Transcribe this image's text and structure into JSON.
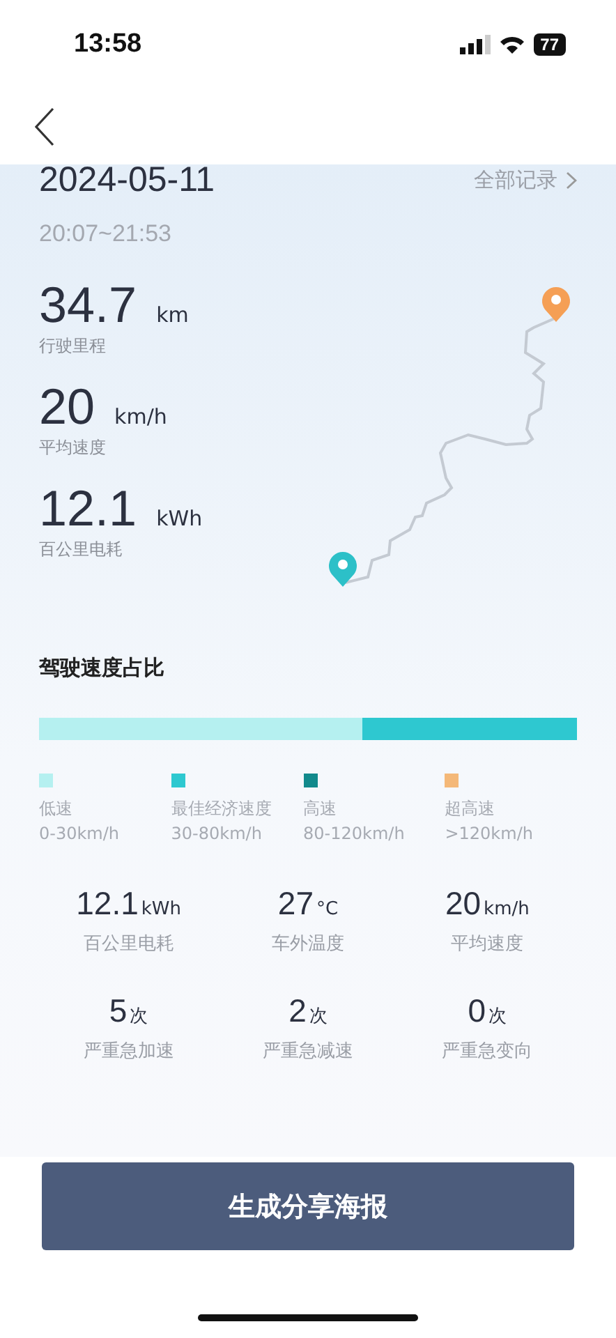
{
  "status_bar": {
    "time": "13:58",
    "battery": "77"
  },
  "header": {
    "date": "2024-05-11",
    "time_range": "20:07~21:53",
    "all_records_link": "全部记录"
  },
  "trip_stats": [
    {
      "value": "34.7",
      "unit": "km",
      "label": "行驶里程"
    },
    {
      "value": "20",
      "unit": "km/h",
      "label": "平均速度"
    },
    {
      "value": "12.1",
      "unit": "kWh",
      "label": "百公里电耗"
    }
  ],
  "speed_section": {
    "title": "驾驶速度占比",
    "bar": [
      {
        "color": "#b5f0f0",
        "level": 0.6
      },
      {
        "color": "#2ec8d0",
        "level": 0.4
      }
    ],
    "bands": [
      {
        "name": "低速",
        "range": "0-30km/h",
        "color": "#b5f0f0"
      },
      {
        "name": "最佳经济速度",
        "range": "30-80km/h",
        "color": "#2ec8d0"
      },
      {
        "name": "高速",
        "range": "80-120km/h",
        "color": "#128a8c"
      },
      {
        "name": "超高速",
        "range": ">120km/h",
        "color": "#f4b878"
      }
    ]
  },
  "summary": [
    {
      "value": "12.1",
      "unit": "kWh",
      "label": "百公里电耗"
    },
    {
      "value": "27",
      "unit": "°C",
      "label": "车外温度"
    },
    {
      "value": "20",
      "unit": "km/h",
      "label": "平均速度"
    },
    {
      "value": "5",
      "unit": "次",
      "label": "严重急加速"
    },
    {
      "value": "2",
      "unit": "次",
      "label": "严重急减速"
    },
    {
      "value": "0",
      "unit": "次",
      "label": "严重急变向"
    }
  ],
  "share_button": "生成分享海报"
}
